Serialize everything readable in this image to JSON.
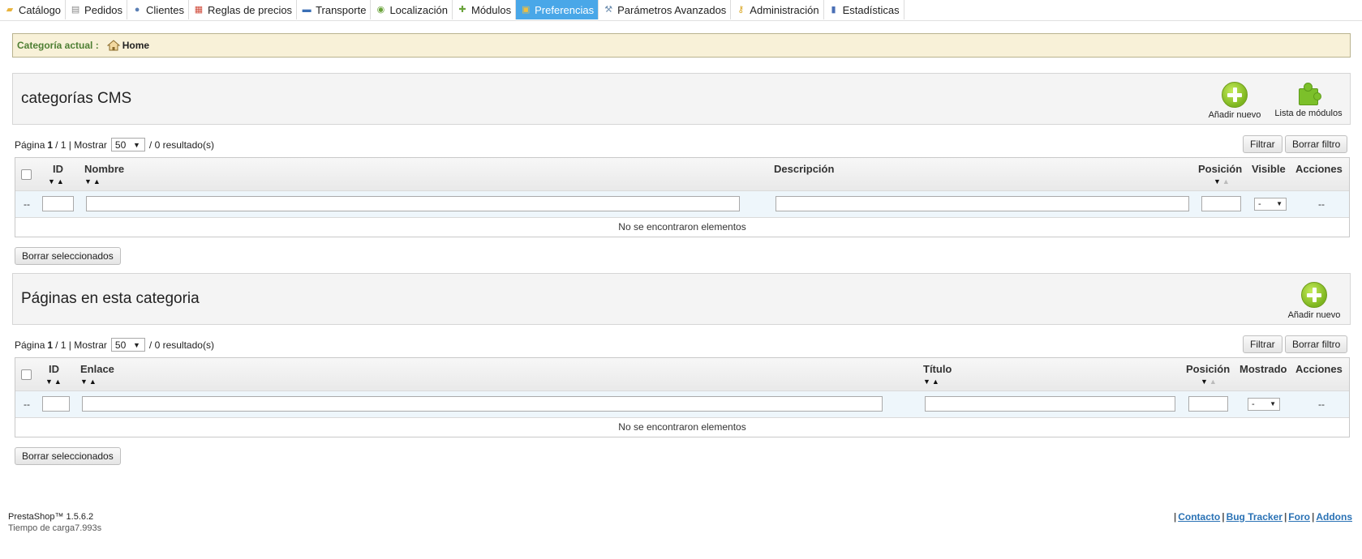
{
  "nav": {
    "tabs": [
      {
        "label": "Catálogo",
        "icon": "folder-icon",
        "color": "#e8b33b"
      },
      {
        "label": "Pedidos",
        "icon": "orders-icon",
        "color": "#888888"
      },
      {
        "label": "Clientes",
        "icon": "user-icon",
        "color": "#5a7fb5"
      },
      {
        "label": "Reglas de precios",
        "icon": "calendar-icon",
        "color": "#d04a3a"
      },
      {
        "label": "Transporte",
        "icon": "truck-icon",
        "color": "#3a6fb5"
      },
      {
        "label": "Localización",
        "icon": "globe-icon",
        "color": "#6aa33b"
      },
      {
        "label": "Módulos",
        "icon": "puzzle-icon",
        "color": "#6aa33b"
      },
      {
        "label": "Preferencias",
        "icon": "preferences-icon",
        "color": "#f0c040"
      },
      {
        "label": "Parámetros Avanzados",
        "icon": "wrench-icon",
        "color": "#6f8fb0"
      },
      {
        "label": "Administración",
        "icon": "key-icon",
        "color": "#d9a520"
      },
      {
        "label": "Estadísticas",
        "icon": "stats-icon",
        "color": "#4a6fb5"
      }
    ],
    "active_index": 7
  },
  "breadcrumb": {
    "label": "Categoría actual :",
    "home": "Home"
  },
  "cms_categories": {
    "title": "categorías CMS",
    "add_new": "Añadir nuevo",
    "modules_list": "Lista de módulos",
    "pagination": {
      "page_label": "Página",
      "page": "1",
      "sep": "/",
      "total_pages": "1",
      "show_label": "| Mostrar",
      "per_page": "50",
      "results": "/ 0 resultado(s)"
    },
    "filter_btn": "Filtrar",
    "reset_btn": "Borrar filtro",
    "columns": {
      "id": "ID",
      "name": "Nombre",
      "description": "Descripción",
      "position": "Posición",
      "visible": "Visible",
      "actions": "Acciones"
    },
    "filter_dash": "--",
    "visible_select": "-",
    "actions_dash": "--",
    "empty": "No se encontraron elementos",
    "delete_selected": "Borrar seleccionados"
  },
  "cms_pages": {
    "title": "Páginas en esta categoria",
    "add_new": "Añadir nuevo",
    "pagination": {
      "page_label": "Página",
      "page": "1",
      "sep": "/",
      "total_pages": "1",
      "show_label": "| Mostrar",
      "per_page": "50",
      "results": "/ 0 resultado(s)"
    },
    "filter_btn": "Filtrar",
    "reset_btn": "Borrar filtro",
    "columns": {
      "id": "ID",
      "link": "Enlace",
      "title": "Título",
      "position": "Posición",
      "shown": "Mostrado",
      "actions": "Acciones"
    },
    "filter_dash": "--",
    "shown_select": "-",
    "actions_dash": "--",
    "empty": "No se encontraron elementos",
    "delete_selected": "Borrar seleccionados"
  },
  "footer": {
    "version": "PrestaShop™ 1.5.6.2",
    "load_time": "Tiempo de carga7.993s",
    "sep": "|",
    "links": [
      "Contacto",
      "Bug Tracker",
      "Foro",
      "Addons"
    ]
  }
}
